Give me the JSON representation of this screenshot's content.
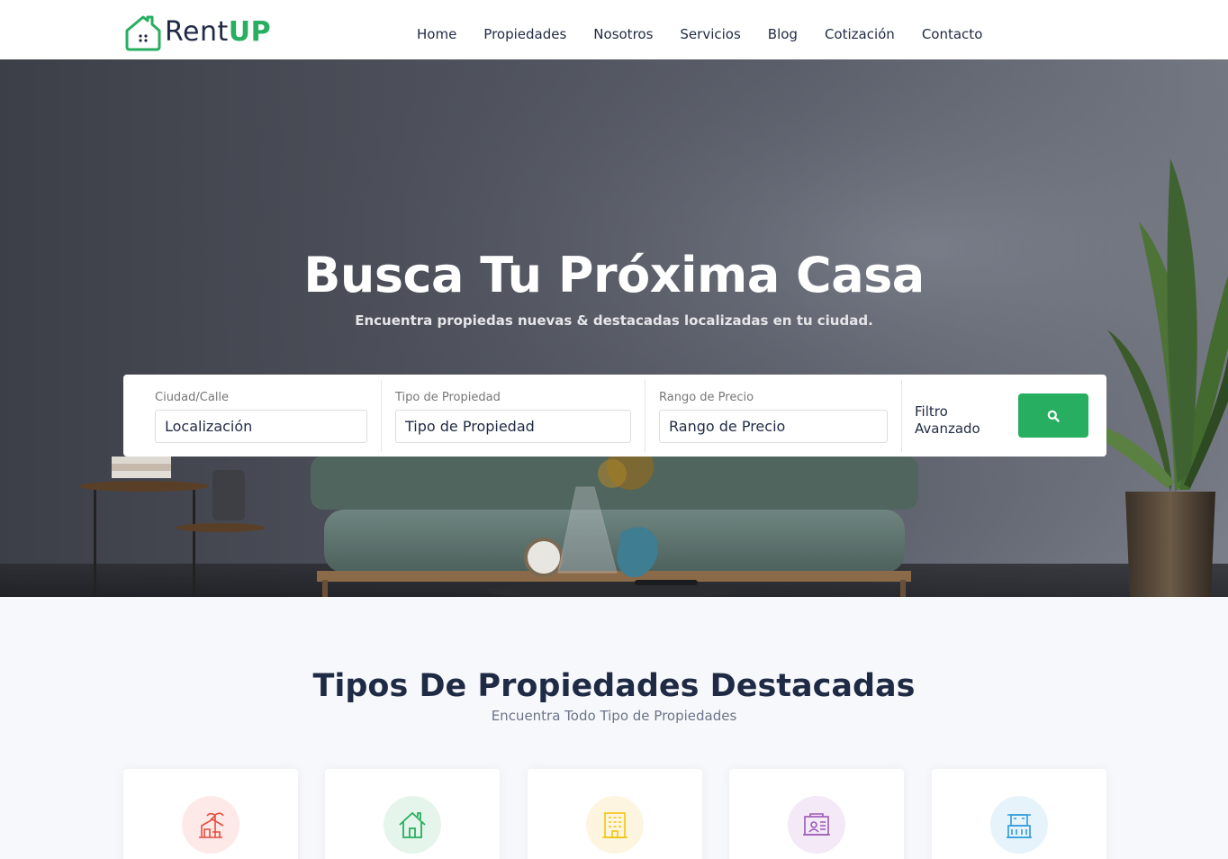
{
  "logo": {
    "rent": "Rent",
    "up": "UP"
  },
  "nav": [
    "Home",
    "Propiedades",
    "Nosotros",
    "Servicios",
    "Blog",
    "Cotización",
    "Contacto"
  ],
  "hero": {
    "title": "Busca Tu Próxima Casa",
    "subtitle": "Encuentra propiedas nuevas & destacadas localizadas en tu ciudad."
  },
  "search": {
    "city_label": "Ciudad/Calle",
    "city_value": "Localización",
    "type_label": "Tipo de Propiedad",
    "type_value": "Tipo de Propiedad",
    "price_label": "Rango de Precio",
    "price_value": "Rango de Precio",
    "advanced_line1": "Filtro",
    "advanced_line2": "Avanzado"
  },
  "section": {
    "title": "Tipos De Propiedades Destacadas",
    "subtitle": "Encuentra Todo Tipo de Propiedades"
  },
  "cards": [
    {
      "icon": "beach-house-icon",
      "color": "#e74c3c",
      "bg": "#fde9e8"
    },
    {
      "icon": "house-icon",
      "color": "#27ae60",
      "bg": "#e6f5eb"
    },
    {
      "icon": "apartment-building-icon",
      "color": "#f1c40f",
      "bg": "#fdf5e0"
    },
    {
      "icon": "office-icon",
      "color": "#9b59b6",
      "bg": "#f4e9f7"
    },
    {
      "icon": "villa-icon",
      "color": "#2e9bdb",
      "bg": "#e6f3fb"
    }
  ],
  "colors": {
    "accent": "#27ae60",
    "text": "#1f2a44"
  }
}
